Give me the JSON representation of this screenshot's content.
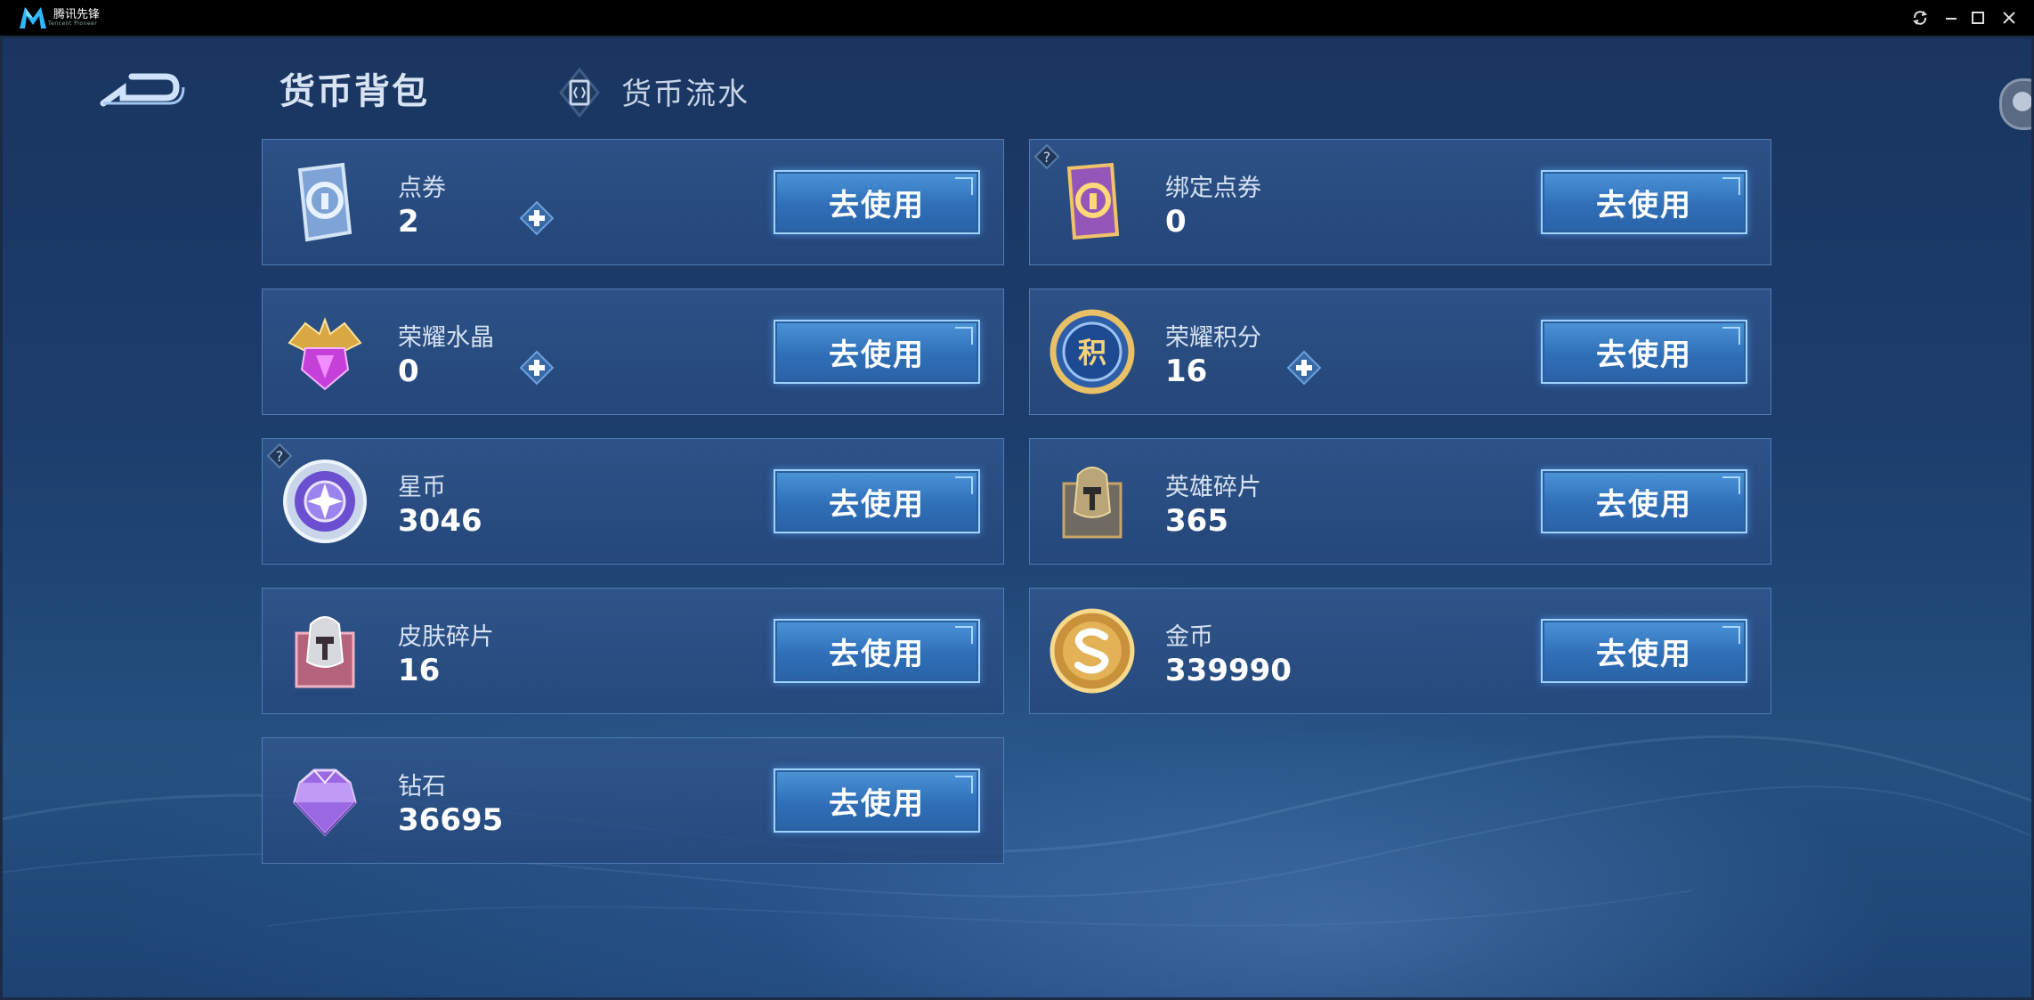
{
  "titlebar": {
    "app_name": "腾讯先锋",
    "app_sub": "Tencent Pioneer",
    "controls": [
      "refresh-icon",
      "minimize-icon",
      "maximize-icon",
      "close-icon"
    ]
  },
  "header": {
    "active_tab": "货币背包",
    "inactive_tab": "货币流水"
  },
  "button_label": "去使用",
  "currencies": [
    {
      "name": "点券",
      "value": "2",
      "has_plus": true,
      "has_help": false,
      "icon": "coupon-card-icon"
    },
    {
      "name": "绑定点券",
      "value": "0",
      "has_plus": false,
      "has_help": true,
      "icon": "bound-coupon-card-icon"
    },
    {
      "name": "荣耀水晶",
      "value": "0",
      "has_plus": true,
      "has_help": false,
      "icon": "glory-crystal-icon"
    },
    {
      "name": "荣耀积分",
      "value": "16",
      "has_plus": true,
      "has_help": false,
      "icon": "glory-points-icon"
    },
    {
      "name": "星币",
      "value": "3046",
      "has_plus": false,
      "has_help": true,
      "icon": "star-coin-icon"
    },
    {
      "name": "英雄碎片",
      "value": "365",
      "has_plus": false,
      "has_help": false,
      "icon": "hero-fragment-icon"
    },
    {
      "name": "皮肤碎片",
      "value": "16",
      "has_plus": false,
      "has_help": false,
      "icon": "skin-fragment-icon"
    },
    {
      "name": "金币",
      "value": "339990",
      "has_plus": false,
      "has_help": false,
      "icon": "gold-coin-icon"
    },
    {
      "name": "钻石",
      "value": "36695",
      "has_plus": false,
      "has_help": false,
      "icon": "diamond-icon"
    }
  ]
}
